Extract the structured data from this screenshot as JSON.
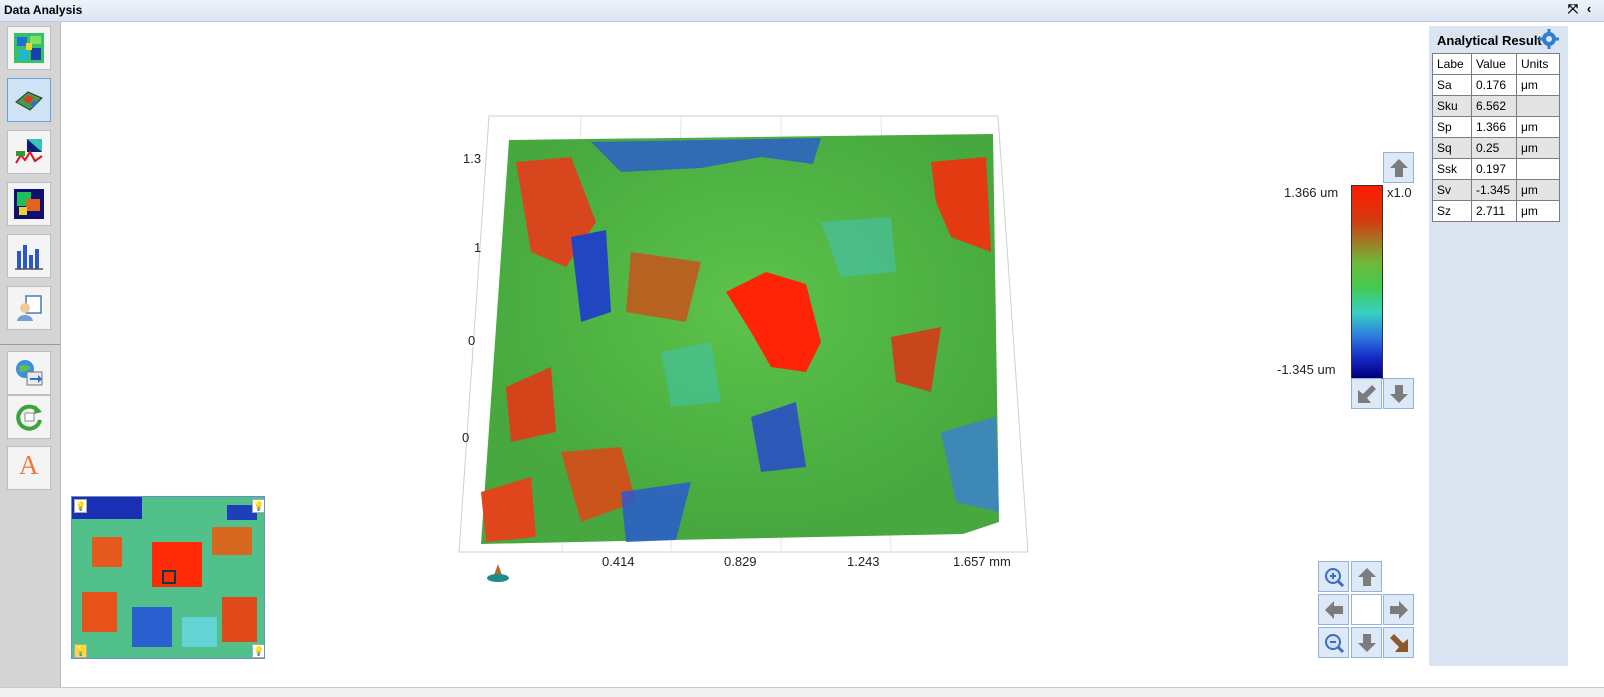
{
  "window": {
    "title": "Data Analysis"
  },
  "toolbar": {
    "tools": [
      {
        "icon": "height-map-2d-icon"
      },
      {
        "icon": "surface-3d-view-icon"
      },
      {
        "icon": "profile-extraction-icon"
      },
      {
        "icon": "surface-texture-icon"
      },
      {
        "icon": "histogram-icon"
      },
      {
        "icon": "user-report-icon"
      },
      {
        "icon": "export-data-icon"
      },
      {
        "icon": "refresh-icon"
      },
      {
        "icon": "text-annotation-icon"
      }
    ],
    "text_tool_glyph": "A"
  },
  "view3d": {
    "y_ticks": [
      "1.3",
      "1",
      "0",
      "0"
    ],
    "x_ticks": [
      "0.414",
      "0.829",
      "1.243",
      "1.657 mm"
    ]
  },
  "colorbar": {
    "max_label": "1.366 um",
    "min_label": "-1.345 um",
    "scale": "x1.0",
    "colors": [
      "#ff1a00",
      "#6fb93a",
      "#2e7de0",
      "#00007a"
    ]
  },
  "results": {
    "title": "Analytical Result",
    "columns": [
      "Labe",
      "Value",
      "Units"
    ],
    "rows": [
      {
        "label": "Sa",
        "value": "0.176",
        "unit": "μm"
      },
      {
        "label": "Sku",
        "value": "6.562",
        "unit": ""
      },
      {
        "label": "Sp",
        "value": "1.366",
        "unit": "μm"
      },
      {
        "label": "Sq",
        "value": "0.25",
        "unit": "μm"
      },
      {
        "label": "Ssk",
        "value": "0.197",
        "unit": ""
      },
      {
        "label": "Sv",
        "value": "-1.345",
        "unit": "μm"
      },
      {
        "label": "Sz",
        "value": "2.711",
        "unit": "μm"
      }
    ]
  }
}
